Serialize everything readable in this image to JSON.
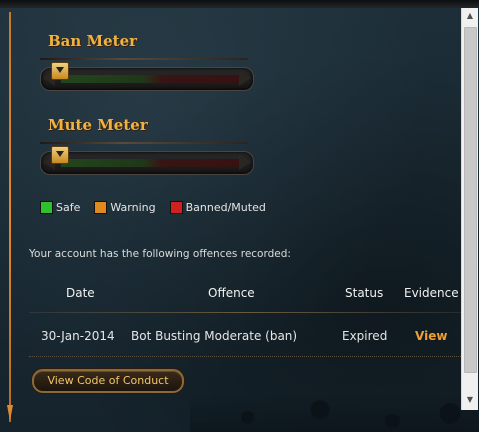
{
  "ban_meter": {
    "title": "Ban Meter",
    "level": 0.0
  },
  "mute_meter": {
    "title": "Mute Meter",
    "level": 0.0
  },
  "legend": [
    {
      "label": "Safe",
      "color": "#2fbf2f"
    },
    {
      "label": "Warning",
      "color": "#e08a1e"
    },
    {
      "label": "Banned/Muted",
      "color": "#d02020"
    }
  ],
  "offences": {
    "intro": "Your account has the following offences recorded:",
    "columns": {
      "date": "Date",
      "offence": "Offence",
      "status": "Status",
      "evidence": "Evidence"
    },
    "rows": [
      {
        "date": "30-Jan-2014",
        "offence": "Bot Busting Moderate (ban)",
        "status": "Expired",
        "evidence": "View"
      }
    ]
  },
  "code_of_conduct_button": "View Code of Conduct",
  "scrollbar": {
    "up_icon": "▲",
    "down_icon": "▼"
  },
  "colors": {
    "accent": "#f0a030",
    "title": "#f0b340",
    "background": "#15222c"
  }
}
